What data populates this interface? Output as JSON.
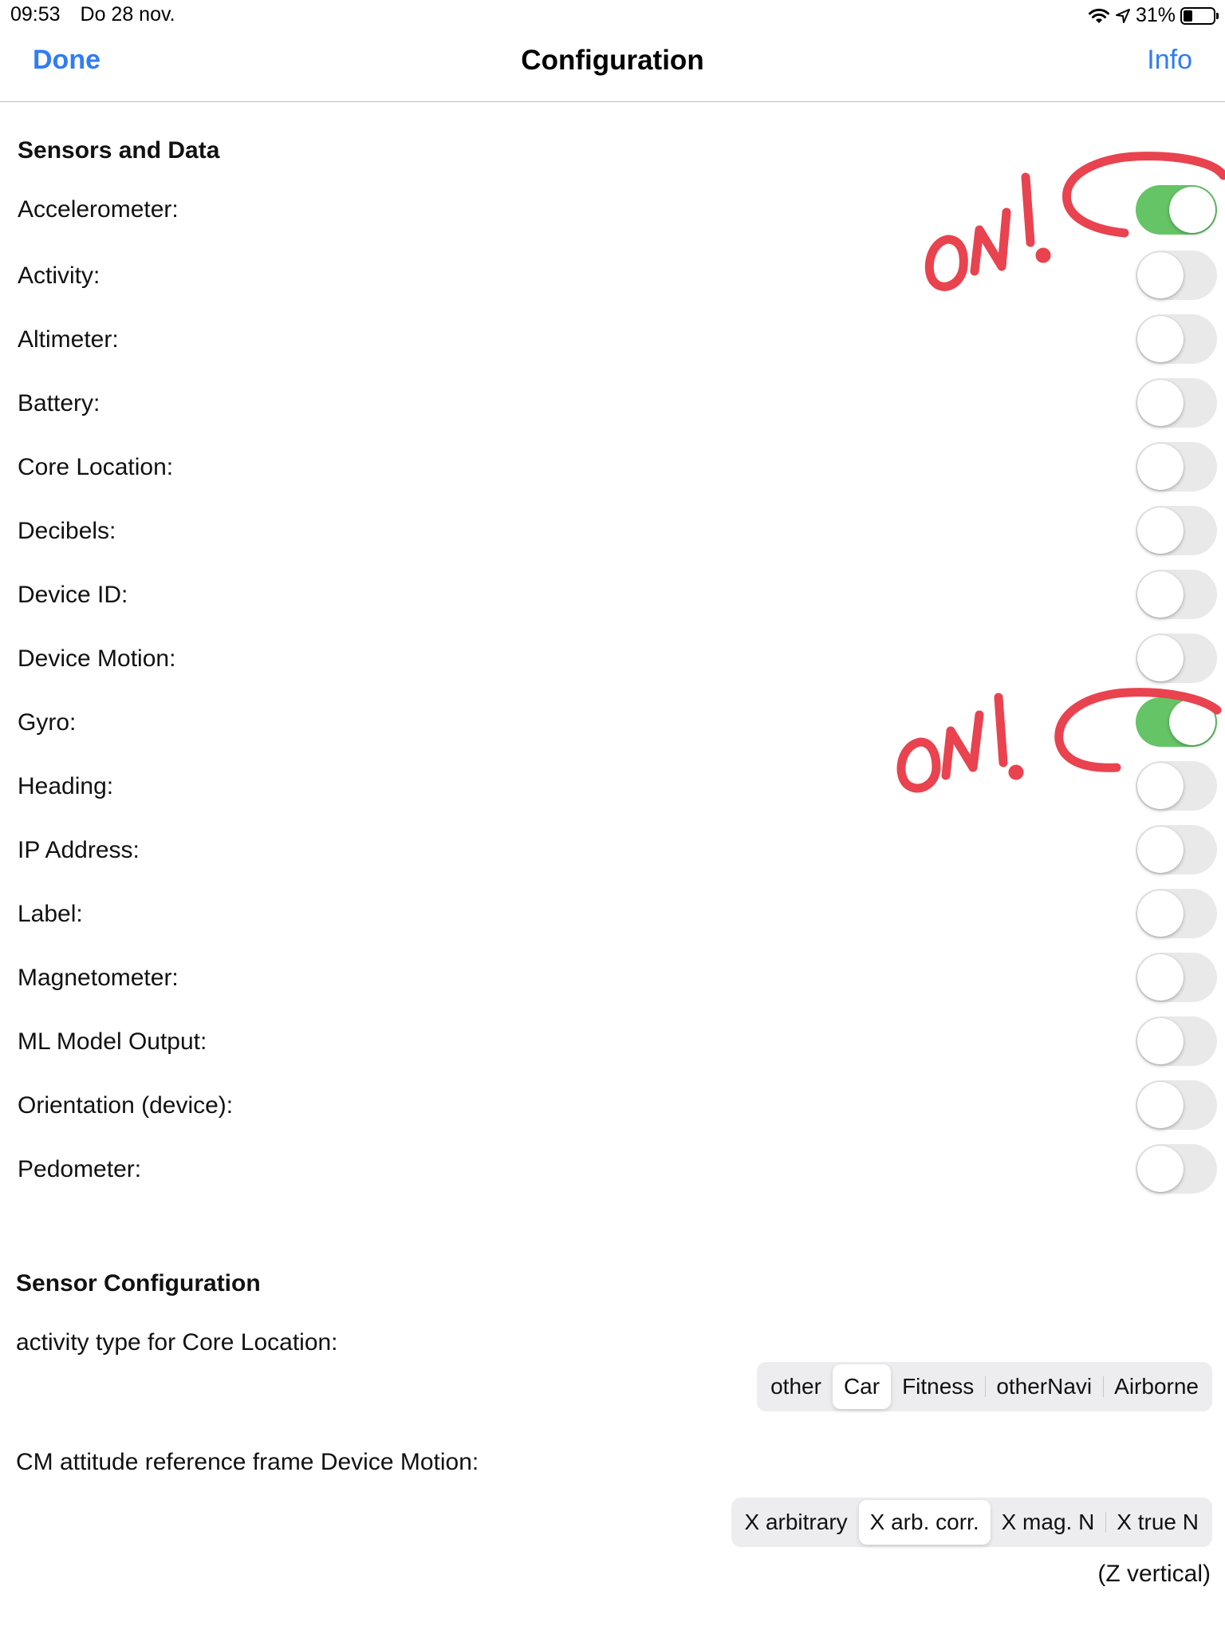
{
  "status_bar": {
    "time": "09:53",
    "date": "Do 28 nov.",
    "battery_percent": "31%",
    "battery_level": 0.31,
    "icons": [
      "wifi-icon",
      "location-arrow-icon",
      "battery-icon"
    ]
  },
  "nav": {
    "done_label": "Done",
    "title": "Configuration",
    "info_label": "Info",
    "accent_color": "#2f7cf6"
  },
  "sensors": {
    "header": "Sensors and Data",
    "items": [
      {
        "label": "Accelerometer:",
        "on": true
      },
      {
        "label": "Activity:",
        "on": false
      },
      {
        "label": "Altimeter:",
        "on": false
      },
      {
        "label": "Battery:",
        "on": false
      },
      {
        "label": "Core Location:",
        "on": false
      },
      {
        "label": "Decibels:",
        "on": false
      },
      {
        "label": "Device ID:",
        "on": false
      },
      {
        "label": "Device Motion:",
        "on": false
      },
      {
        "label": "Gyro:",
        "on": true
      },
      {
        "label": "Heading:",
        "on": false
      },
      {
        "label": "IP Address:",
        "on": false
      },
      {
        "label": "Label:",
        "on": false
      },
      {
        "label": "Magnetometer:",
        "on": false
      },
      {
        "label": "ML Model Output:",
        "on": false
      },
      {
        "label": "Orientation (device):",
        "on": false
      },
      {
        "label": "Pedometer:",
        "on": false
      }
    ],
    "toggle_on_color": "#65c466"
  },
  "sensor_config": {
    "header": "Sensor Configuration",
    "activity_type_label": "activity type for Core Location:",
    "activity_type_options": [
      "other",
      "Car",
      "Fitness",
      "otherNavi",
      "Airborne"
    ],
    "activity_type_selected": "Car",
    "attitude_label": "CM attitude reference frame Device Motion:",
    "attitude_options": [
      "X arbitrary",
      "X arb. corr.",
      "X mag. N",
      "X true N"
    ],
    "attitude_selected": "X arb. corr.",
    "attitude_note": "(Z vertical)"
  },
  "annotations": {
    "color": "#e8434f",
    "marks": [
      "ON!",
      "ON!"
    ]
  }
}
